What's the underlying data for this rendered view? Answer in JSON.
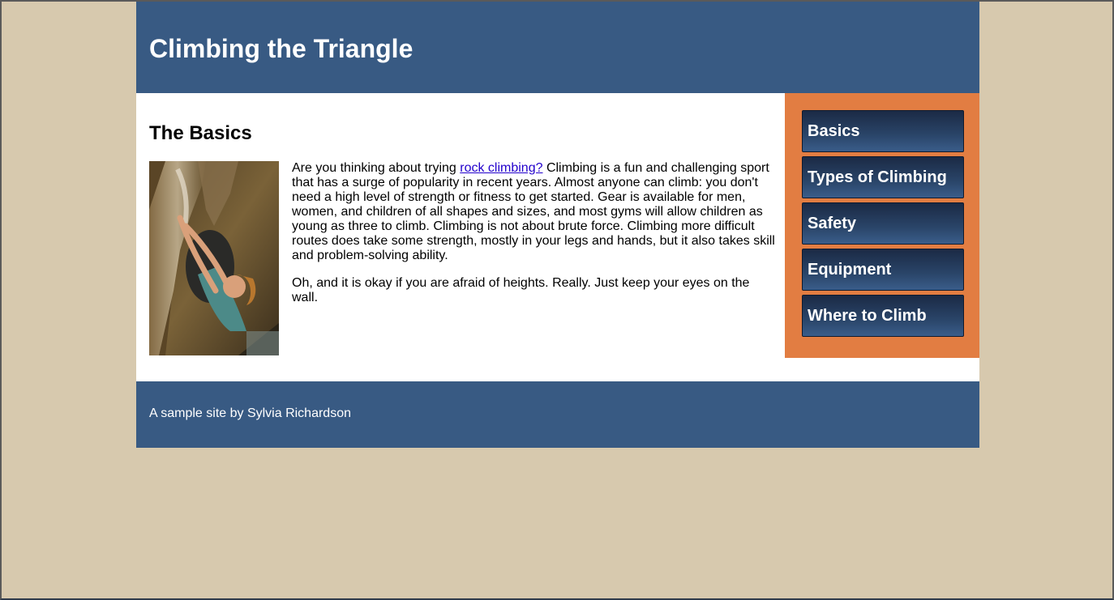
{
  "header": {
    "title": "Climbing the Triangle"
  },
  "main": {
    "heading": "The Basics",
    "image_alt": "Woman rock climbing",
    "paragraph1": {
      "before_link": "Are you thinking about trying ",
      "link_text": "rock climbing?",
      "after_link": " Climbing is a fun and challenging sport that has a surge of popularity in recent years. Almost anyone can climb: you don't need a high level of strength or fitness to get started. Gear is available for men, women, and children of all shapes and sizes, and most gyms will allow children as young as three to climb. Climbing is not about brute force. Climbing more difficult routes does take some strength, mostly in your legs and hands, but it also takes skill and problem-solving ability."
    },
    "paragraph2": "Oh, and it is okay if you are afraid of heights. Really. Just keep your eyes on the wall."
  },
  "sidebar": {
    "items": [
      {
        "label": "Basics"
      },
      {
        "label": "Types of Climbing"
      },
      {
        "label": "Safety"
      },
      {
        "label": "Equipment"
      },
      {
        "label": "Where to Climb"
      }
    ]
  },
  "footer": {
    "text": "A sample site by Sylvia Richardson"
  },
  "colors": {
    "page_background": "#d7c9ae",
    "header_footer": "#385a83",
    "sidebar": "#e27d42",
    "nav_button": "#2a4569",
    "link": "#2200cc"
  }
}
